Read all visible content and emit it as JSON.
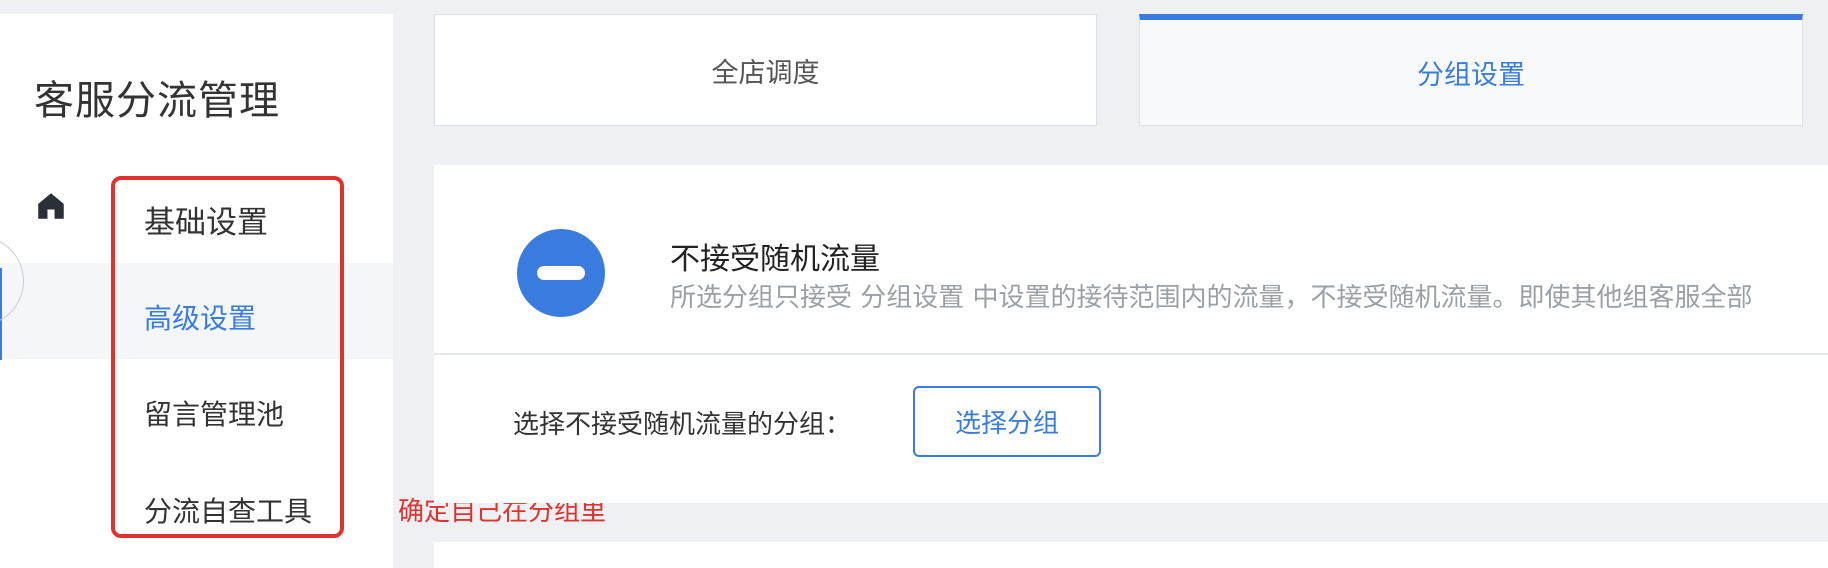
{
  "sidebar": {
    "title": "客服分流管理",
    "items": [
      {
        "label": "基础设置"
      },
      {
        "label": "高级设置"
      },
      {
        "label": "留言管理池"
      },
      {
        "label": "分流自查工具"
      }
    ]
  },
  "annotation": {
    "text": "确定自己在分组里"
  },
  "tabs": [
    {
      "label": "全店调度"
    },
    {
      "label": "分组设置"
    }
  ],
  "feature": {
    "title": "不接受随机流量",
    "description": "所选分组只接受 分组设置 中设置的接待范围内的流量，不接受随机流量。即使其他组客服全部"
  },
  "group_select": {
    "label": "选择不接受随机流量的分组：",
    "button_label": "选择分组"
  },
  "colors": {
    "accent": "#3a7be0",
    "annotation": "#e0322c"
  }
}
